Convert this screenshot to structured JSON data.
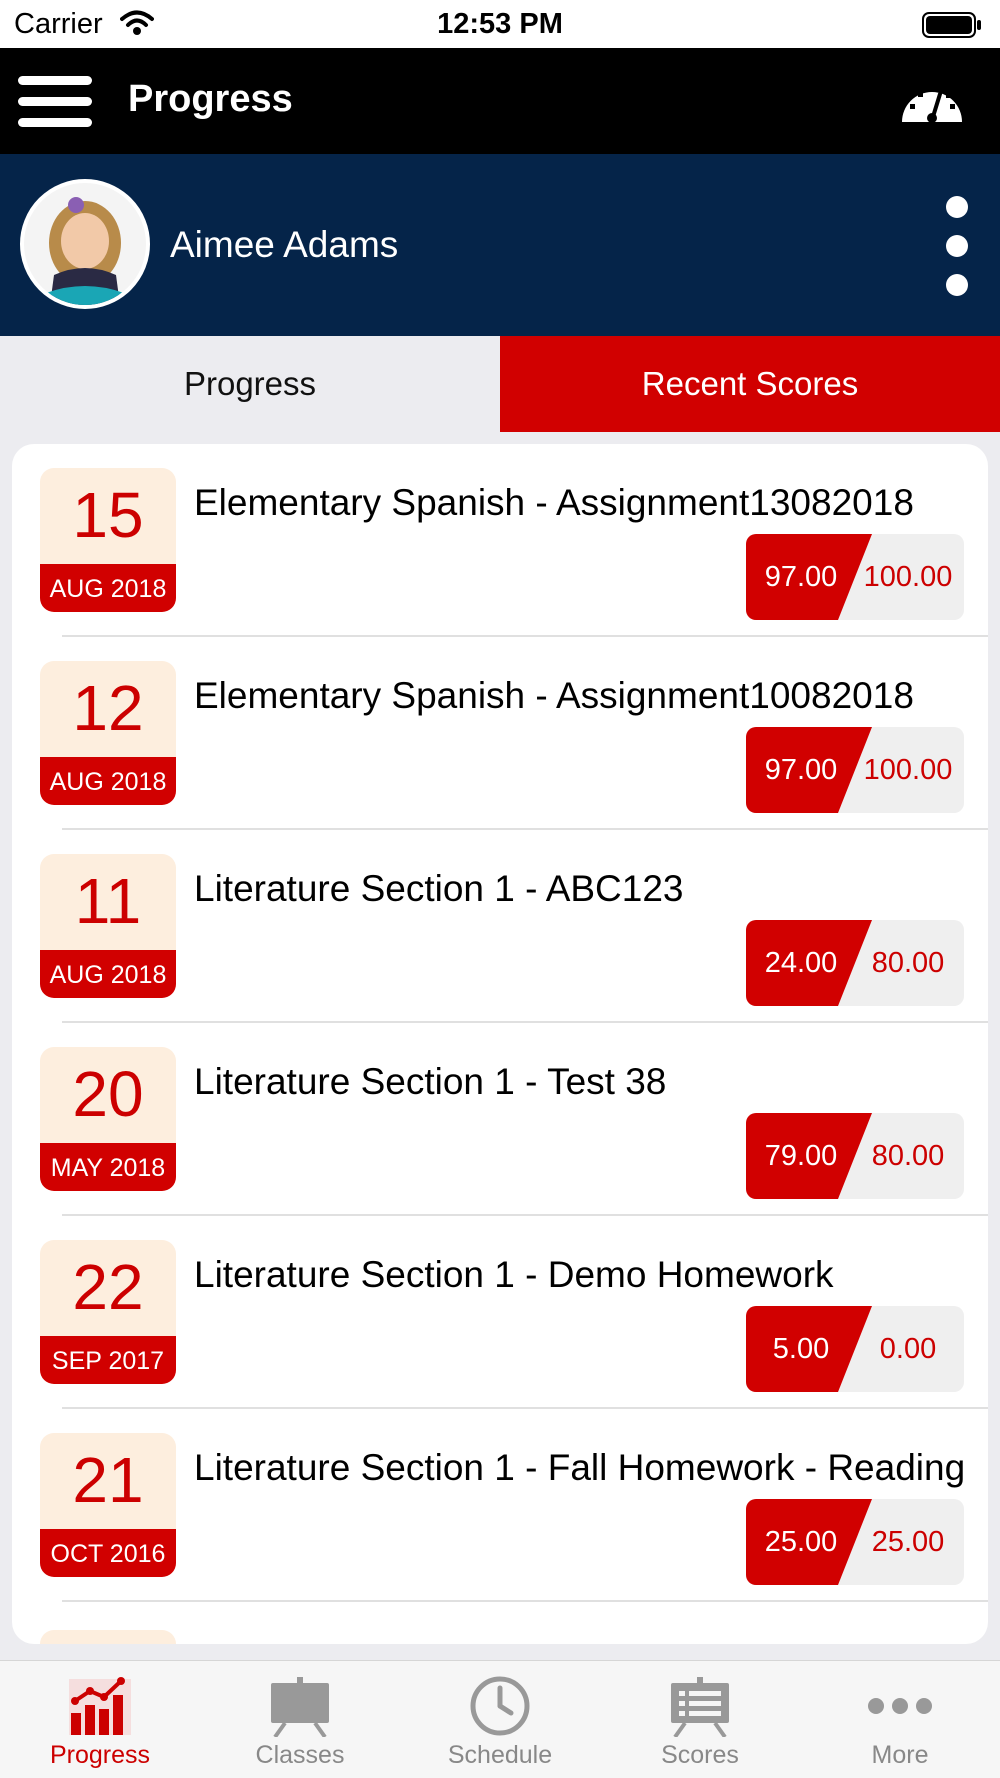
{
  "status_bar": {
    "carrier": "Carrier",
    "time": "12:53 PM"
  },
  "header": {
    "title": "Progress",
    "menu_icon": "hamburger-menu-icon",
    "right_icon": "gauge-icon"
  },
  "student": {
    "name": "Aimee Adams",
    "more_icon": "vertical-dots-icon"
  },
  "tabs": [
    {
      "label": "Progress",
      "active": false
    },
    {
      "label": "Recent Scores",
      "active": true
    }
  ],
  "scores": [
    {
      "day": "15",
      "month": "AUG 2018",
      "title": "Elementary Spanish - Assignment13082018",
      "score": "97.00",
      "max": "100.00"
    },
    {
      "day": "12",
      "month": "AUG 2018",
      "title": "Elementary Spanish - Assignment10082018",
      "score": "97.00",
      "max": "100.00"
    },
    {
      "day": "11",
      "month": "AUG 2018",
      "title": "Literature Section 1 - ABC123",
      "score": "24.00",
      "max": "80.00"
    },
    {
      "day": "20",
      "month": "MAY 2018",
      "title": "Literature Section 1 - Test 38",
      "score": "79.00",
      "max": "80.00"
    },
    {
      "day": "22",
      "month": "SEP 2017",
      "title": "Literature Section 1 - Demo Homework",
      "score": "5.00",
      "max": "0.00"
    },
    {
      "day": "21",
      "month": "OCT 2016",
      "title": "Literature Section 1 - Fall Homework - Reading",
      "score": "25.00",
      "max": "25.00"
    }
  ],
  "bottom_nav": [
    {
      "label": "Progress",
      "icon": "bar-chart-icon",
      "active": true
    },
    {
      "label": "Classes",
      "icon": "easel-icon",
      "active": false
    },
    {
      "label": "Schedule",
      "icon": "clock-icon",
      "active": false
    },
    {
      "label": "Scores",
      "icon": "scoreboard-icon",
      "active": false
    },
    {
      "label": "More",
      "icon": "more-dots-icon",
      "active": false
    }
  ],
  "colors": {
    "accent": "#d10000",
    "header_bg": "#000000",
    "student_bar_bg": "#052449",
    "date_badge_bg": "#fdeede"
  }
}
